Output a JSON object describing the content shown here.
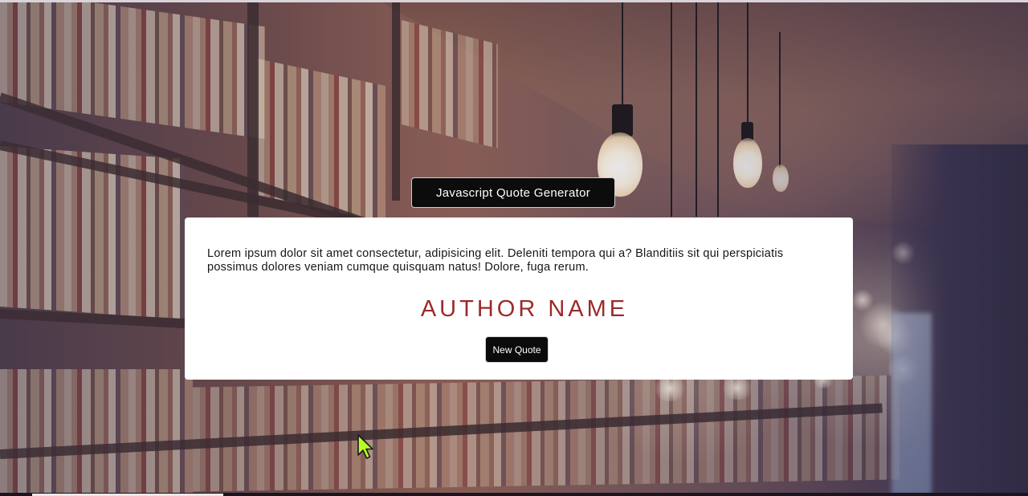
{
  "header": {
    "title_button_label": "Javascript Quote Generator"
  },
  "quote": {
    "text": "Lorem ipsum dolor sit amet consectetur, adipisicing elit. Deleniti tempora qui a? Blanditiis sit qui perspiciatis possimus dolores veniam cumque quisquam natus! Dolore, fuga rerum.",
    "author": "AUTHOR NAME",
    "new_quote_label": "New Quote"
  },
  "colors": {
    "author": "#9b2b2b",
    "button_bg": "#0b0b0b",
    "card_bg": "#ffffff",
    "cursor": "#b8ff2a"
  },
  "icons": {
    "cursor": "mouse-pointer-icon"
  }
}
